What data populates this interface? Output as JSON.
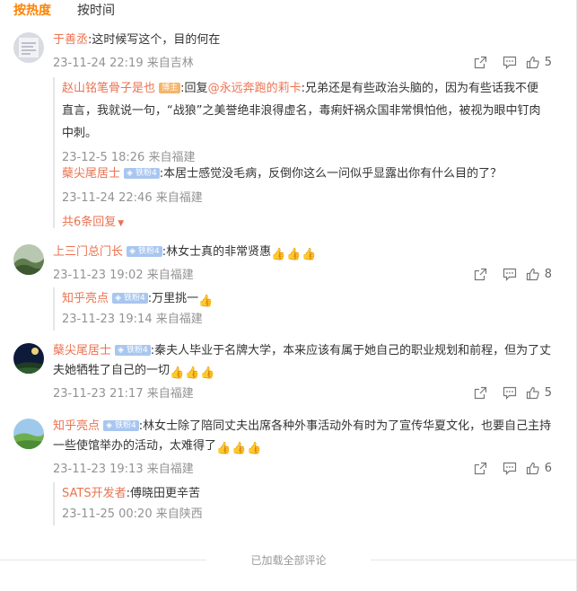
{
  "tabs": {
    "hot": "按热度",
    "time": "按时间"
  },
  "comments": [
    {
      "user": "于善丞",
      "text": ":这时候写这个，目的何在",
      "meta": "23-11-24 22:19 来自吉林",
      "likes": "5",
      "replies": [
        {
          "user": "赵山铭笔骨子是也",
          "badge": "博主",
          "reply_prefix": ":回复",
          "reply_to": "@永远奔跑的莉卡",
          "text_line1": ":兄弟还是有些政治头脑的，因为有些话我不便",
          "text_line2": "直言，我就说一句，“战狼”之美誉绝非浪得虚名，毒痢奸祸众国非常惧怕他，被视为眼中钉肉",
          "text_line3": "中刺。",
          "meta": "23-12-5 18:26 来自福建"
        },
        {
          "user": "蘖尖尾居士",
          "badge": "铁粉4",
          "text": ":本居士感觉没毛病，反倒你这么一问似乎显露出你有什么目的了？",
          "meta": "23-11-24 22:46 来自福建"
        }
      ],
      "more": "共6条回复"
    },
    {
      "user": "上三门总门长",
      "badge": "铁粉4",
      "text": ":林女士真的非常贤惠",
      "meta": "23-11-23 19:02 来自福建",
      "likes": "8",
      "replies": [
        {
          "user": "知乎亮点",
          "badge": "铁粉4",
          "text": ":万里挑一",
          "meta": "23-11-23 19:14 来自福建"
        }
      ]
    },
    {
      "user": "蘖尖尾居士",
      "badge": "铁粉4",
      "text_line1": ":秦夫人毕业于名牌大学，本来应该有属于她自己的职业规划和前程，但为了丈",
      "text_line2": "夫她牺牲了自己的一切",
      "meta": "23-11-23 21:17 来自福建",
      "likes": "5"
    },
    {
      "user": "知乎亮点",
      "badge": "铁粉4",
      "text_line1": ":林女士除了陪同丈夫出席各种外事活动外有时为了宣传华夏文化，也要自己主持",
      "text_line2": "一些使馆举办的活动，太难得了",
      "meta": "23-11-23 19:13 来自福建",
      "likes": "6",
      "replies": [
        {
          "user": "SATS开发者",
          "text": ":傅晓田更辛苦",
          "meta": "23-11-25 00:20 来自陕西"
        }
      ]
    }
  ],
  "footer": "已加载全部评论",
  "colors": {
    "accent": "#ff8200",
    "username": "#eb7350",
    "meta": "#939393"
  }
}
